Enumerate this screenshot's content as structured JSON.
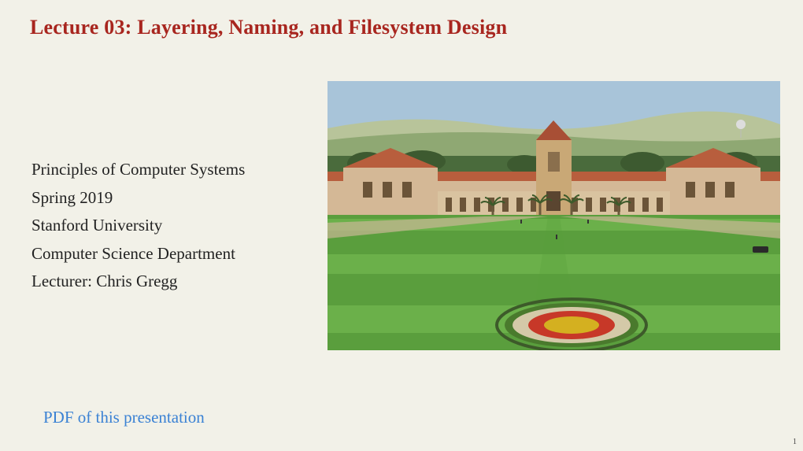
{
  "title": "Lecture 03: Layering, Naming, and Filesystem Design",
  "course": {
    "name": "Principles of Computer Systems",
    "term": "Spring 2019",
    "university": "Stanford University",
    "department": "Computer Science Department",
    "lecturer": "Lecturer: Chris Gregg"
  },
  "pdf_link_text": "PDF of this presentation",
  "page_number": "1"
}
